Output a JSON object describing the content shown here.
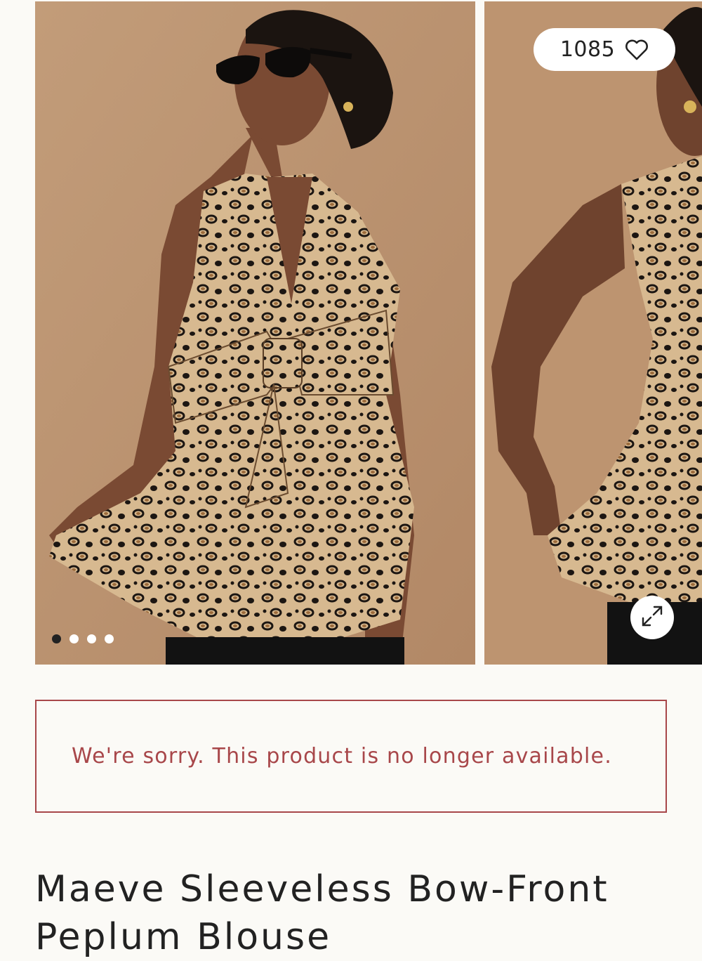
{
  "gallery": {
    "favorite_count": "1085",
    "dots_total": 4,
    "dots_active_index": 0,
    "icons": [
      "heart-icon",
      "expand-icon"
    ]
  },
  "notice": {
    "message": "We're sorry. This product is no longer available.",
    "color": "#a8474a"
  },
  "product": {
    "title": "Maeve Sleeveless Bow-Front Peplum Blouse"
  },
  "colors": {
    "background": "#fbfaf6",
    "photo_background": "#b9906d"
  }
}
